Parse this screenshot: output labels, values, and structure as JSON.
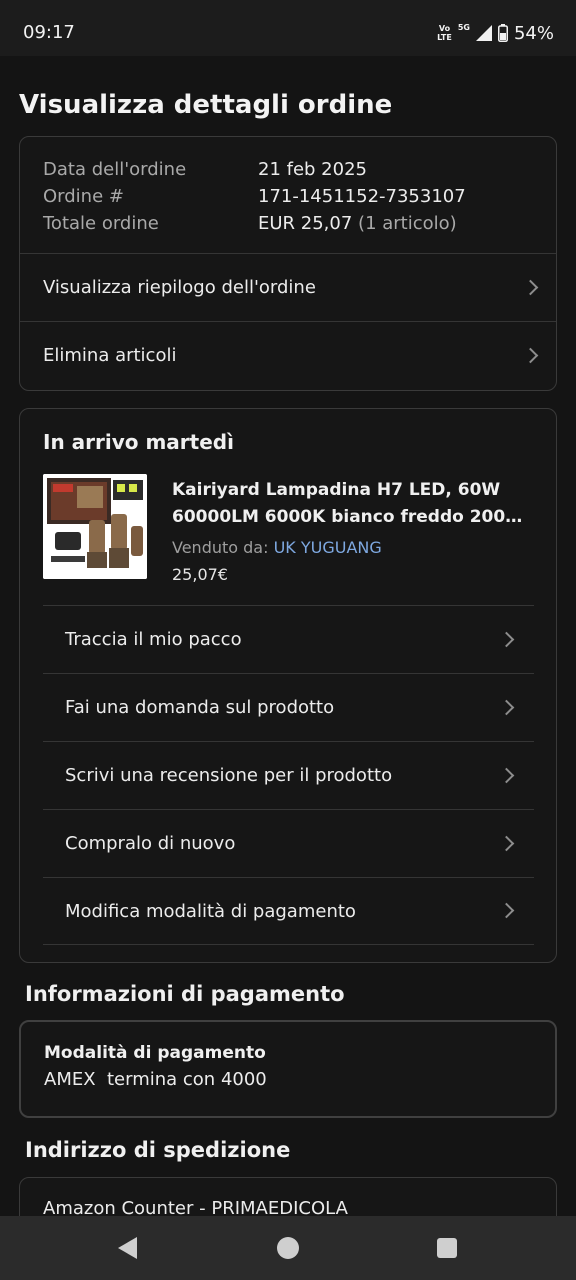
{
  "status_bar": {
    "time": "09:17",
    "volte_top": "Vo",
    "volte_bottom": "LTE",
    "network": "5G",
    "battery": "54%"
  },
  "page_title": "Visualizza dettagli ordine",
  "order_summary": {
    "date_label": "Data dell'ordine",
    "date_value": "21 feb 2025",
    "order_label": "Ordine #",
    "order_value": "171-1451152-7353107",
    "total_label": "Totale ordine",
    "total_value": "EUR 25,07",
    "total_items": "(1 articolo)",
    "view_summary": "Visualizza riepilogo dell'ordine",
    "delete_items": "Elimina articoli"
  },
  "delivery": {
    "heading": "In arrivo martedì",
    "product_title": "Kairiyard Lampadina H7 LED, 60W 60000LM 6000K bianco freddo 200…",
    "seller_label": "Venduto da:",
    "seller_name": "UK YUGUANG",
    "price": "25,07€",
    "actions": [
      "Traccia il mio pacco",
      "Fai una domanda sul prodotto",
      "Scrivi una recensione per il prodotto",
      "Compralo di nuovo",
      "Modifica modalità di pagamento"
    ]
  },
  "payment": {
    "section_title": "Informazioni di pagamento",
    "method_label": "Modalità di pagamento",
    "method_value": "AMEX  termina con 4000"
  },
  "shipping": {
    "section_title": "Indirizzo di spedizione",
    "address_line": "Amazon Counter - PRIMAEDICOLA"
  },
  "icons": {
    "chevron": "chevron-right-icon",
    "nav_back": "back-triangle-icon",
    "nav_home": "home-circle-icon",
    "nav_recents": "recents-square-icon"
  },
  "colors": {
    "background": "#141414",
    "card_border": "#3a3a3a",
    "link": "#7ea8e0"
  }
}
